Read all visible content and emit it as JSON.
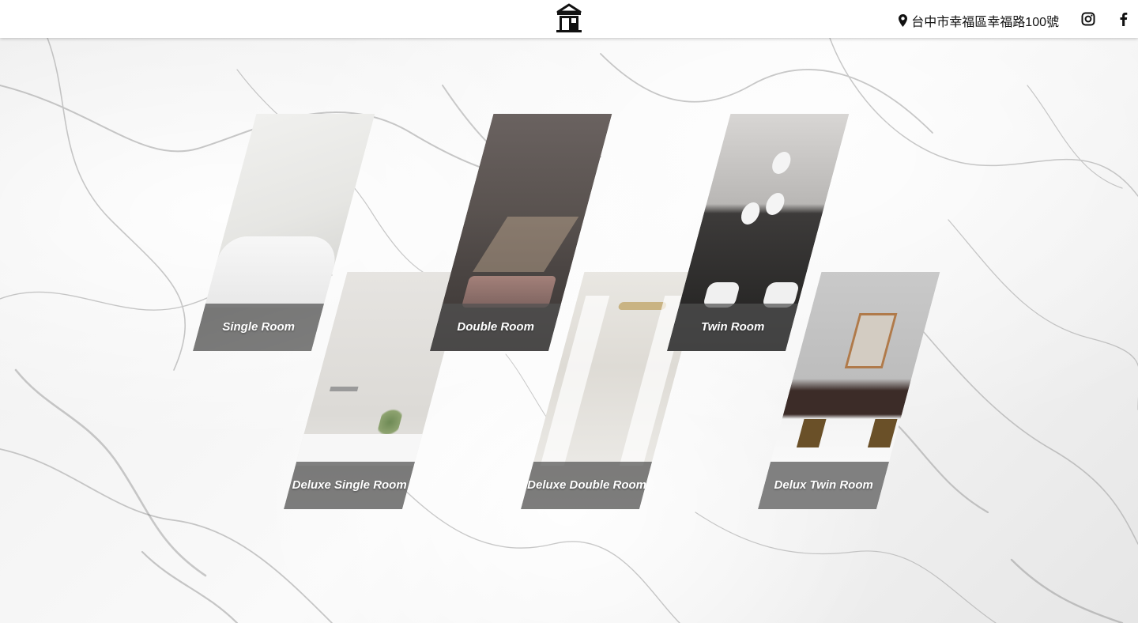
{
  "header": {
    "logo": "house-logo-icon",
    "address": "台中市幸福區幸福路100號",
    "address_icon": "map-pin-icon",
    "social": [
      "instagram-icon",
      "facebook-icon"
    ]
  },
  "rooms": [
    {
      "name": "Single Room"
    },
    {
      "name": "Double Room"
    },
    {
      "name": "Twin Room"
    },
    {
      "name": "Deluxe Single Room"
    },
    {
      "name": "Deluxe Double Room"
    },
    {
      "name": "Delux Twin Room"
    }
  ],
  "colors": {
    "header_bg": "#ffffff",
    "caption_bg": "#505050",
    "caption_text": "#ffffff",
    "background": "#f4f4f4"
  }
}
